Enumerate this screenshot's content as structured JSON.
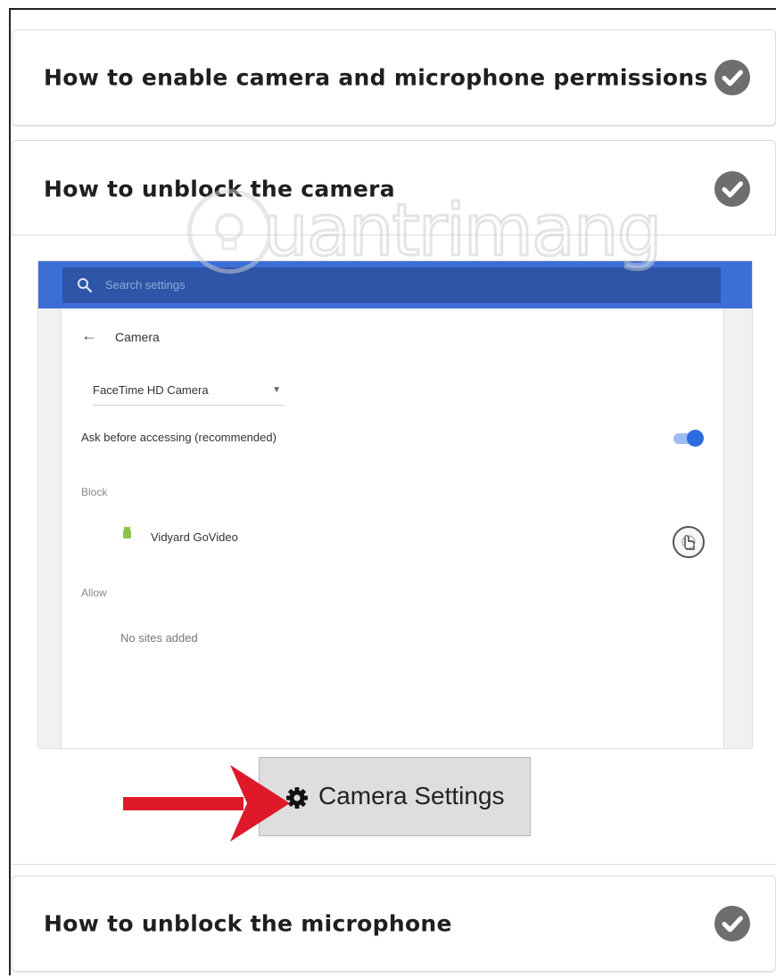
{
  "sections": {
    "permissions": {
      "title": "How to enable camera and microphone permissions",
      "completed": true
    },
    "camera": {
      "title": "How to unblock the camera",
      "completed": true
    },
    "microphone": {
      "title": "How to unblock the microphone",
      "completed": true
    }
  },
  "watermark": {
    "text": "uantrimang"
  },
  "settings_screenshot": {
    "search_placeholder": "Search settings",
    "page_title": "Camera",
    "device_select": "FaceTime HD Camera",
    "ask_label": "Ask before accessing (recommended)",
    "ask_enabled": true,
    "block_heading": "Block",
    "blocked_sites": [
      {
        "name": "Vidyard GoVideo"
      }
    ],
    "allow_heading": "Allow",
    "allow_empty": "No sites added"
  },
  "camera_settings_button": {
    "label": "Camera Settings",
    "icon": "gear-icon"
  },
  "colors": {
    "accent_blue": "#3b6fd6",
    "arrow_red": "#e0192a",
    "check_gray": "#6e6e6e"
  }
}
